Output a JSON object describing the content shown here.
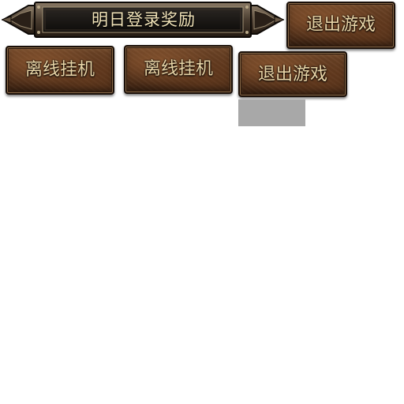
{
  "banner": {
    "title": "明日登录奖励"
  },
  "buttons": {
    "exit_top": "退出游戏",
    "afk_1": "离线挂机",
    "afk_2": "离线挂机",
    "exit_bottom": "退出游戏"
  },
  "colors": {
    "label_text": "#e8d4a6",
    "banner_text": "#f1e3b8",
    "leather_mid": "#5a351c",
    "frame_dark": "#1a0f08",
    "placeholder_grey": "#a8a8a8"
  }
}
